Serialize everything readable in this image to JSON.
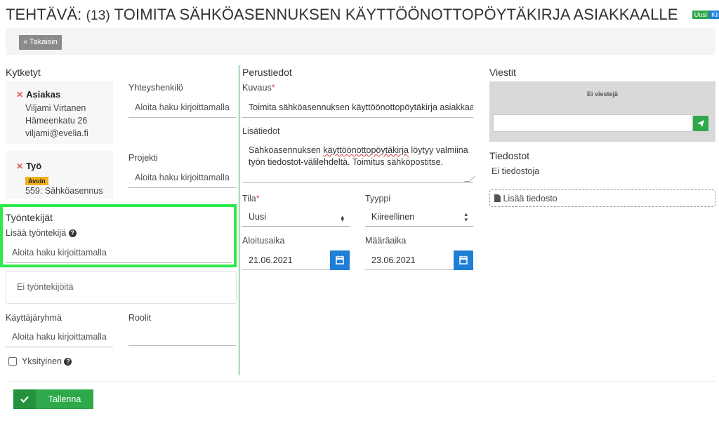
{
  "header": {
    "prefix": "TEHTÄVÄ:",
    "number": "(13)",
    "title": "TOIMITA SÄHKÖASENNUKSEN KÄYTTÖÖNOTTOPÖYTÄKIRJA ASIAKKAALLE",
    "badges": [
      "Uusi",
      "Kiireellinen"
    ]
  },
  "toolbar": {
    "back_label": "« Takaisin"
  },
  "kytketyt": {
    "title": "Kytketyt",
    "customer": {
      "label": "Asiakas",
      "name": "Viljami Virtanen",
      "address": "Hämeenkatu 26",
      "email": "viljami@evelia.fi"
    },
    "contact": {
      "label": "Yhteyshenkilö",
      "placeholder": "Aloita haku kirjoittamalla"
    },
    "work": {
      "label": "Työ",
      "status": "Avoin",
      "ref": "559: Sähköasennus"
    },
    "project": {
      "label": "Projekti",
      "placeholder": "Aloita haku kirjoittamalla"
    }
  },
  "workers": {
    "title": "Työntekijät",
    "add_label": "Lisää työntekijä",
    "placeholder": "Aloita haku kirjoittamalla",
    "empty": "Ei työntekijöitä"
  },
  "usergroup": {
    "label": "Käyttäjäryhmä",
    "placeholder": "Aloita haku kirjoittamalla"
  },
  "roles": {
    "label": "Roolit",
    "value": ""
  },
  "private": {
    "label": "Yksityinen",
    "checked": false
  },
  "basic": {
    "title": "Perustiedot",
    "description_label": "Kuvaus",
    "description_value": "Toimita sähköasennuksen käyttöönottopöytäkirja asiakkaalle",
    "extra_label": "Lisätiedot",
    "extra_text_1": "Sähköasennuksen ",
    "extra_text_spell": "käyttöönottopöytäkirja",
    "extra_text_2": " löytyy valmiina",
    "extra_text_3": "työn tiedostot-välilehdeltä. Toimitus sähköpostitse.",
    "state_label": "Tila",
    "state_value": "Uusi",
    "type_label": "Tyyppi",
    "type_value": "Kiireellinen",
    "start_label": "Aloitusaika",
    "start_value": "21.06.2021",
    "due_label": "Määräaika",
    "due_value": "23.06.2021"
  },
  "messages": {
    "title": "Viestit",
    "empty": "Ei viestejä",
    "input_value": ""
  },
  "files": {
    "title": "Tiedostot",
    "empty": "Ei tiedostoja",
    "add_label": "Lisää tiedosto"
  },
  "footer": {
    "save_label": "Tallenna"
  },
  "colors": {
    "green": "#2ea84a",
    "blue": "#1f7fd6",
    "highlight": "#2ee94a",
    "avoin": "#f2b21c"
  }
}
